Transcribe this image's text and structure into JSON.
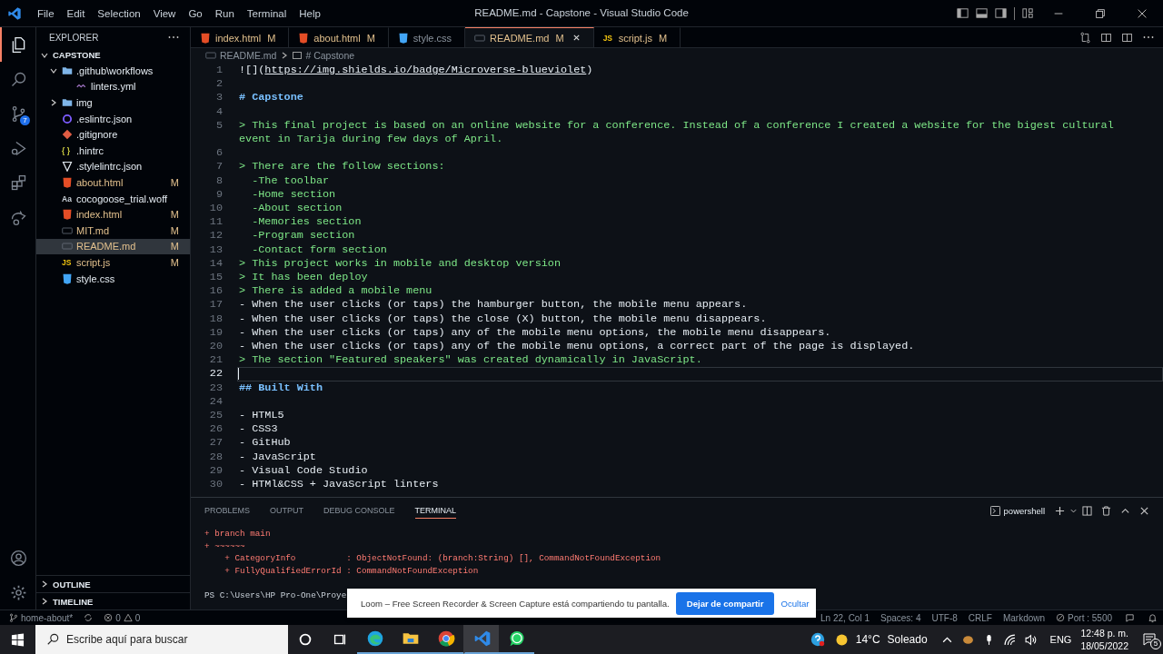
{
  "window": {
    "title": "README.md - Capstone - Visual Studio Code"
  },
  "menu": [
    "File",
    "Edit",
    "Selection",
    "View",
    "Go",
    "Run",
    "Terminal",
    "Help"
  ],
  "activity_bar": [
    {
      "kind": "explorer",
      "selected": true
    },
    {
      "kind": "search",
      "selected": false
    },
    {
      "kind": "source-control",
      "selected": false,
      "badge": "7"
    },
    {
      "kind": "run",
      "selected": false
    },
    {
      "kind": "extensions",
      "selected": false
    },
    {
      "kind": "remote",
      "selected": false
    }
  ],
  "activity_bottom": [
    {
      "kind": "account"
    },
    {
      "kind": "settings"
    }
  ],
  "explorer": {
    "title": "EXPLORER",
    "folder": "CAPSTONE",
    "expanded": true,
    "tree": [
      {
        "name": ".github\\workflows",
        "kind": "folder",
        "expanded": true,
        "modified": false,
        "selected": false,
        "children": [
          {
            "name": "linters.yml",
            "kind": "yaml",
            "modified": false,
            "selected": false
          }
        ]
      },
      {
        "name": "img",
        "kind": "folder",
        "expanded": false,
        "modified": false,
        "selected": false
      },
      {
        "name": ".eslintrc.json",
        "kind": "eslint",
        "modified": false,
        "selected": false
      },
      {
        "name": ".gitignore",
        "kind": "git",
        "modified": false,
        "selected": false
      },
      {
        "name": ".hintrc",
        "kind": "braces",
        "icon_text": "{ }",
        "modified": false,
        "selected": false
      },
      {
        "name": ".stylelintrc.json",
        "kind": "stylelint",
        "modified": false,
        "selected": false
      },
      {
        "name": "about.html",
        "kind": "html",
        "modified": true,
        "status": "M",
        "selected": false
      },
      {
        "name": "cocogoose_trial.woff",
        "kind": "font",
        "icon_text": "Aa",
        "modified": false,
        "selected": false
      },
      {
        "name": "index.html",
        "kind": "html",
        "modified": true,
        "status": "M",
        "selected": false
      },
      {
        "name": "MIT.md",
        "kind": "markdown",
        "modified": true,
        "status": "M",
        "selected": false
      },
      {
        "name": "README.md",
        "kind": "markdown",
        "modified": true,
        "status": "M",
        "selected": true
      },
      {
        "name": "script.js",
        "kind": "js",
        "icon_text": "JS",
        "modified": true,
        "status": "M",
        "selected": false
      },
      {
        "name": "style.css",
        "kind": "css",
        "modified": false,
        "selected": false
      }
    ],
    "sections": [
      {
        "label": "OUTLINE",
        "expanded": false
      },
      {
        "label": "TIMELINE",
        "expanded": false
      }
    ]
  },
  "tabs": [
    {
      "label": "index.html",
      "kind": "html",
      "modified": true,
      "status": "M",
      "selected": false
    },
    {
      "label": "about.html",
      "kind": "html",
      "modified": true,
      "status": "M",
      "selected": false
    },
    {
      "label": "style.css",
      "kind": "css",
      "modified": false,
      "selected": false
    },
    {
      "label": "README.md",
      "kind": "markdown",
      "modified": true,
      "status": "M",
      "selected": true
    },
    {
      "label": "script.js",
      "kind": "js",
      "icon_text": "JS",
      "modified": true,
      "status": "M",
      "selected": false
    }
  ],
  "breadcrumb": [
    "README.md",
    "# Capstone"
  ],
  "editor": {
    "lines": [
      {
        "n": "1",
        "kind": "link",
        "before": "![](",
        "url": "https://img.shields.io/badge/Microverse-blueviolet",
        "after": ")",
        "current": false
      },
      {
        "n": "2",
        "kind": "blank",
        "current": false
      },
      {
        "n": "3",
        "kind": "heading",
        "text": "# Capstone",
        "current": false
      },
      {
        "n": "4",
        "kind": "blank",
        "current": false
      },
      {
        "n": "5",
        "kind": "quote",
        "text": "> This final project is based on an online website for a conference. Instead of a conference I created a website for the bigest cultural event in Tarija during few days of April.",
        "current": false
      },
      {
        "n": "6",
        "kind": "blank",
        "current": false
      },
      {
        "n": "7",
        "kind": "quote",
        "text": "> There are the follow sections:",
        "current": false
      },
      {
        "n": "8",
        "kind": "quote",
        "text": "  -The toolbar",
        "current": false
      },
      {
        "n": "9",
        "kind": "quote",
        "text": "  -Home section",
        "current": false
      },
      {
        "n": "10",
        "kind": "quote",
        "text": "  -About section",
        "current": false
      },
      {
        "n": "11",
        "kind": "quote",
        "text": "  -Memories section",
        "current": false
      },
      {
        "n": "12",
        "kind": "quote",
        "text": "  -Program section",
        "current": false
      },
      {
        "n": "13",
        "kind": "quote",
        "text": "  -Contact form section",
        "current": false
      },
      {
        "n": "14",
        "kind": "quote",
        "text": "> This project works in mobile and desktop version",
        "current": false
      },
      {
        "n": "15",
        "kind": "quote",
        "text": "> It has been deploy",
        "current": false
      },
      {
        "n": "16",
        "kind": "quote",
        "text": "> There is added a mobile menu",
        "current": false
      },
      {
        "n": "17",
        "kind": "plain",
        "text": "- When the user clicks (or taps) the hamburger button, the mobile menu appears.",
        "current": false
      },
      {
        "n": "18",
        "kind": "plain",
        "text": "- When the user clicks (or taps) the close (X) button, the mobile menu disappears.",
        "current": false
      },
      {
        "n": "19",
        "kind": "plain",
        "text": "- When the user clicks (or taps) any of the mobile menu options, the mobile menu disappears.",
        "current": false
      },
      {
        "n": "20",
        "kind": "plain",
        "text": "- When the user clicks (or taps) any of the mobile menu options, a correct part of the page is displayed.",
        "current": false
      },
      {
        "n": "21",
        "kind": "quote",
        "text": "> The section \"Featured speakers\" was created dynamically in JavaScript.",
        "current": false
      },
      {
        "n": "22",
        "kind": "blank",
        "current": true
      },
      {
        "n": "23",
        "kind": "heading",
        "text": "## Built With",
        "current": false
      },
      {
        "n": "24",
        "kind": "blank",
        "current": false
      },
      {
        "n": "25",
        "kind": "plain",
        "text": "- HTML5",
        "current": false
      },
      {
        "n": "26",
        "kind": "plain",
        "text": "- CSS3",
        "current": false
      },
      {
        "n": "27",
        "kind": "plain",
        "text": "- GitHub",
        "current": false
      },
      {
        "n": "28",
        "kind": "plain",
        "text": "- JavaScript",
        "current": false
      },
      {
        "n": "29",
        "kind": "plain",
        "text": "- Visual Code Studio",
        "current": false
      },
      {
        "n": "30",
        "kind": "plain",
        "text": "- HTMl&CSS + JavaScript linters",
        "current": false
      }
    ]
  },
  "panel": {
    "tabs": [
      {
        "label": "PROBLEMS",
        "selected": false
      },
      {
        "label": "OUTPUT",
        "selected": false
      },
      {
        "label": "DEBUG CONSOLE",
        "selected": false
      },
      {
        "label": "TERMINAL",
        "selected": true
      }
    ],
    "shell": "powershell",
    "terminal": [
      {
        "kind": "error",
        "text": "+ branch main"
      },
      {
        "kind": "error",
        "text": "+ ~~~~~~"
      },
      {
        "kind": "error",
        "text": "    + CategoryInfo          : ObjectNotFound: (branch:String) [], CommandNotFoundException"
      },
      {
        "kind": "error",
        "text": "    + FullyQualifiedErrorId : CommandNotFoundException"
      },
      {
        "kind": "prompt",
        "text": "PS C:\\Users\\HP Pro-One\\Proye"
      }
    ]
  },
  "status_bar": {
    "branch": "home-about*",
    "errors": "0",
    "warnings": "0",
    "right": [
      "Ln 22, Col 1",
      "Spaces: 4",
      "UTF-8",
      "CRLF",
      "Markdown"
    ],
    "port": "Port : 5500"
  },
  "notification": {
    "text": "Loom – Free Screen Recorder & Screen Capture está compartiendo tu pantalla.",
    "button": "Dejar de compartir",
    "link": "Ocultar"
  },
  "taskbar": {
    "search_placeholder": "Escribe aquí para buscar",
    "apps": [
      {
        "kind": "edge",
        "active": false
      },
      {
        "kind": "files",
        "active": false
      },
      {
        "kind": "chrome",
        "active": false
      },
      {
        "kind": "vscode",
        "active": true
      },
      {
        "kind": "whatsapp",
        "active": false
      }
    ],
    "temperature": "14°C",
    "weather": "Soleado",
    "language": "ENG",
    "time": "12:48 p. m.",
    "date": "18/05/2022",
    "notifications": "5"
  }
}
